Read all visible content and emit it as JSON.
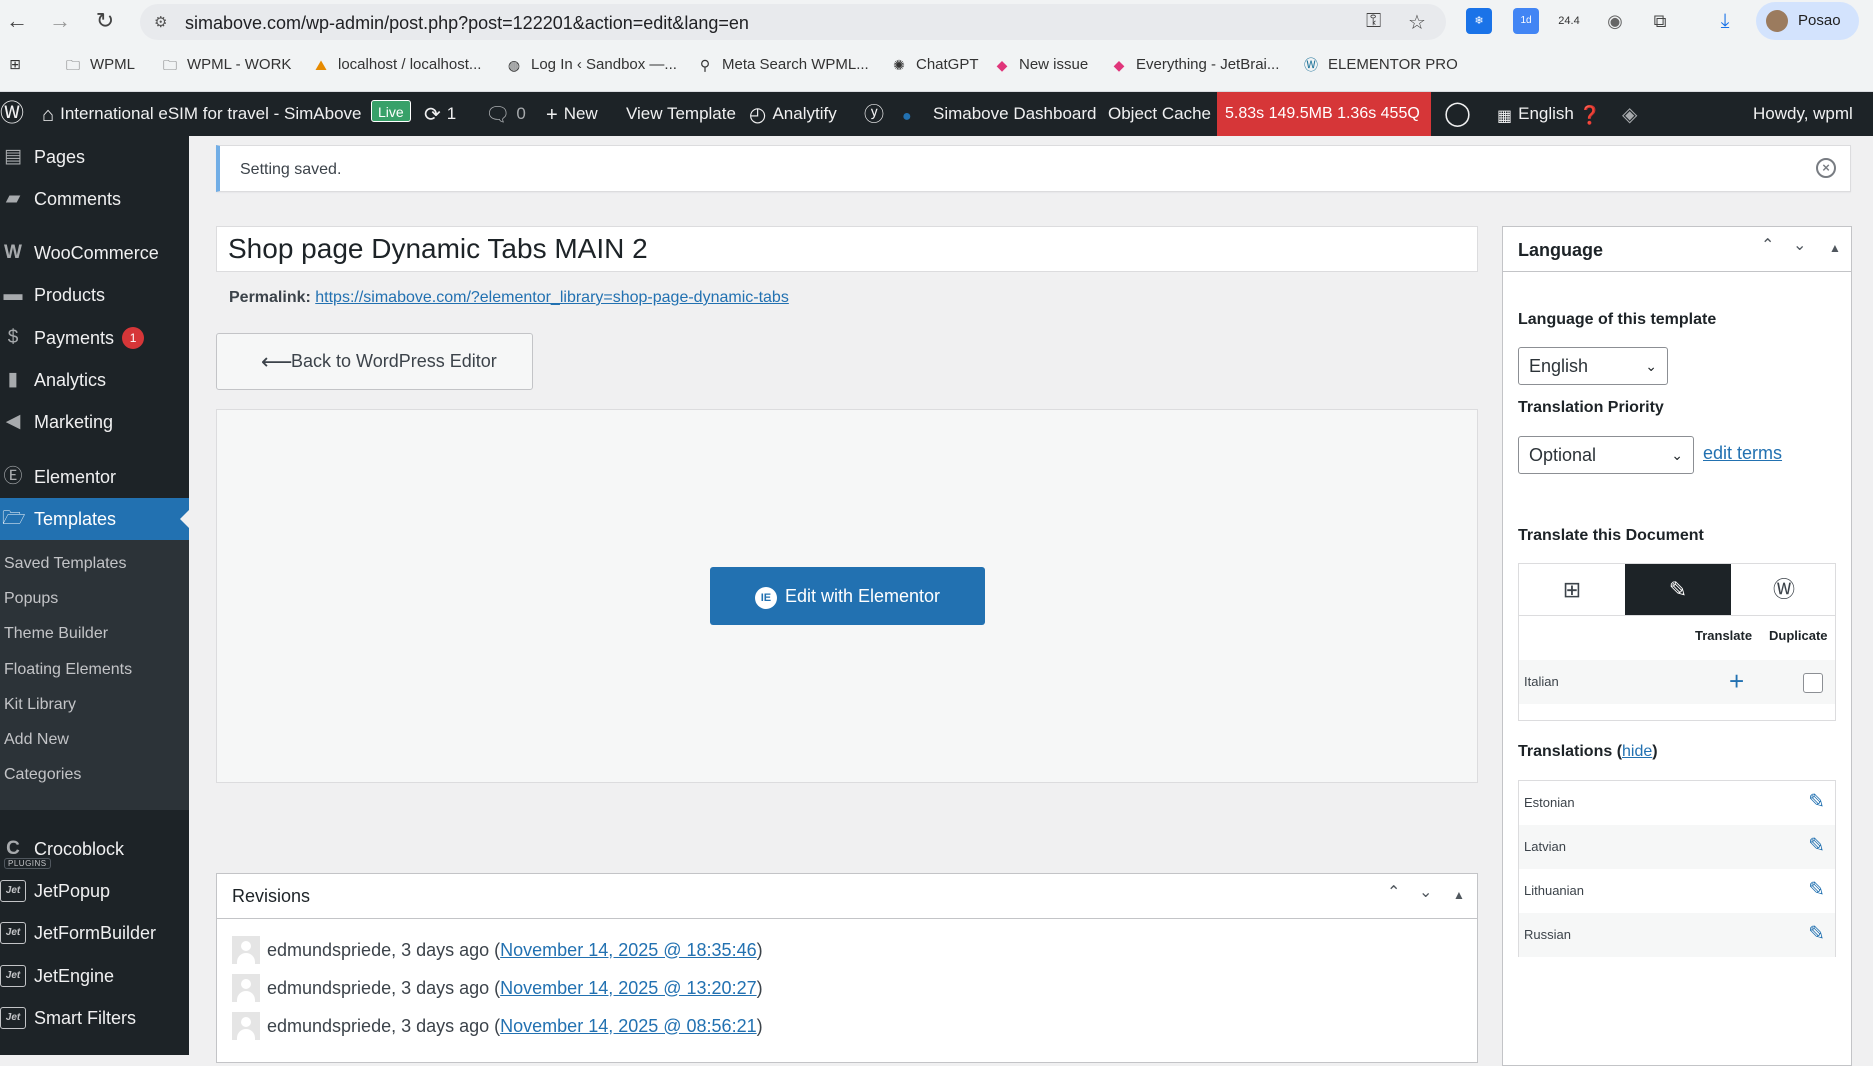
{
  "browser": {
    "url": "simabove.com/wp-admin/post.php?post=122201&action=edit&lang=en",
    "profile_name": "Posao",
    "ext_badge": "1d",
    "ext_counter": "24.4",
    "bookmarks": [
      "WPML",
      "WPML - WORK",
      "localhost / localhost...",
      "Log In ‹ Sandbox —...",
      "Meta Search WPML...",
      "ChatGPT",
      "New issue",
      "Everything - JetBrai...",
      "ELEMENTOR PRO"
    ]
  },
  "adminbar": {
    "site_name": "International eSIM for travel - SimAbove",
    "live": "Live",
    "updates": "1",
    "comments": "0",
    "new": "New",
    "view_template": "View Template",
    "analytify": "Analytify",
    "dashboard": "Simabove Dashboard",
    "object_cache": "Object Cache",
    "perf": "5.83s  149.5MB  1.36s  455Q",
    "language": "English",
    "howdy": "Howdy, wpml"
  },
  "sidebar": {
    "items": [
      "Pages",
      "Comments",
      "WooCommerce",
      "Products",
      "Payments",
      "Analytics",
      "Marketing",
      "Elementor",
      "Templates"
    ],
    "payments_badge": "1",
    "submenu": [
      "Saved Templates",
      "Popups",
      "Theme Builder",
      "Floating Elements",
      "Kit Library",
      "Add New",
      "Categories"
    ],
    "crocoblock": "Crocoblock",
    "plugins_label": "PLUGINS",
    "jet_icon": "Jet",
    "plugins": [
      "JetPopup",
      "JetFormBuilder",
      "JetEngine",
      "Smart Filters"
    ]
  },
  "notice": {
    "text": "Setting saved."
  },
  "post": {
    "title": "Shop page Dynamic Tabs MAIN 2",
    "permalink_label": "Permalink:",
    "permalink_url": "https://simabove.com/?elementor_library=shop-page-dynamic-tabs",
    "back_label": "Back to WordPress Editor",
    "elementor_label": "Edit with Elementor"
  },
  "revisions": {
    "title": "Revisions",
    "rows": [
      {
        "author": "edmundspriede, 3 days ago",
        "date": "November 14, 2025 @ 18:35:46"
      },
      {
        "author": "edmundspriede, 3 days ago",
        "date": "November 14, 2025 @ 13:20:27"
      },
      {
        "author": "edmundspriede, 3 days ago",
        "date": "November 14, 2025 @ 08:56:21"
      }
    ]
  },
  "language_box": {
    "title": "Language",
    "lang_label": "Language of this template",
    "lang_value": "English",
    "priority_label": "Translation Priority",
    "priority_value": "Optional",
    "edit_terms": "edit terms",
    "translate_label": "Translate this Document",
    "col_translate": "Translate",
    "col_duplicate": "Duplicate",
    "target_lang": "Italian",
    "translations_label": "Translations",
    "hide_link": "hide",
    "translations": [
      "Estonian",
      "Latvian",
      "Lithuanian",
      "Russian"
    ]
  },
  "colors": {
    "wp_blue": "#2271b1",
    "admin_dark": "#1d2327",
    "perf_red": "#d63638",
    "notice_blue": "#72aee6"
  }
}
